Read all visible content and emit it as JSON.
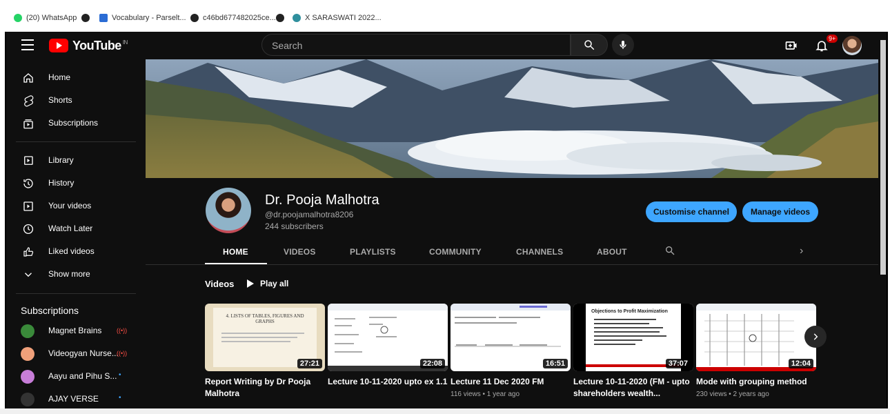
{
  "bookmarks": [
    {
      "label": "(20) WhatsApp",
      "color": "#25d366"
    },
    {
      "label": "",
      "color": "#333333"
    },
    {
      "label": "Vocabulary - Parselt...",
      "color": "#2b6cd4"
    },
    {
      "label": "c46bd677482025ce...",
      "color": "#333333"
    },
    {
      "label": "",
      "color": "#333333"
    },
    {
      "label": "X SARASWATI 2022...",
      "color": "#2f8f9d"
    }
  ],
  "topbar": {
    "logo_text": "YouTube",
    "region": "IN",
    "search_placeholder": "Search",
    "notification_badge": "9+"
  },
  "sidebar": {
    "items": [
      {
        "label": "Home",
        "icon": "home-icon"
      },
      {
        "label": "Shorts",
        "icon": "shorts-icon"
      },
      {
        "label": "Subscriptions",
        "icon": "subscriptions-icon"
      },
      {
        "label": "Library",
        "icon": "library-icon"
      },
      {
        "label": "History",
        "icon": "history-icon"
      },
      {
        "label": "Your videos",
        "icon": "your-videos-icon"
      },
      {
        "label": "Watch Later",
        "icon": "clock-icon"
      },
      {
        "label": "Liked videos",
        "icon": "thumbs-up-icon"
      },
      {
        "label": "Show more",
        "icon": "chevron-down-icon"
      }
    ],
    "subscriptions_title": "Subscriptions",
    "subscriptions": [
      {
        "label": "Magnet Brains",
        "live": true,
        "color": "#3a8a3a"
      },
      {
        "label": "Videogyan Nurse...",
        "live": true,
        "color": "#f0a07a"
      },
      {
        "label": "Aayu and Pihu S...",
        "live": false,
        "color": "#c77dd8"
      },
      {
        "label": "AJAY VERSE",
        "live": false,
        "color": "#333333"
      }
    ]
  },
  "channel": {
    "name": "Dr. Pooja Malhotra",
    "handle": "@dr.poojamalhotra8206",
    "subscribers": "244 subscribers",
    "customise_label": "Customise channel",
    "manage_label": "Manage videos"
  },
  "tabs": [
    "HOME",
    "VIDEOS",
    "PLAYLISTS",
    "COMMUNITY",
    "CHANNELS",
    "ABOUT"
  ],
  "section": {
    "title": "Videos",
    "play_all": "Play all"
  },
  "videos": [
    {
      "title": "Report Writing by Dr Pooja Malhotra",
      "duration": "27:21",
      "meta": "",
      "thumb_heading": "4. LISTS OF TABLES, FIGURES AND GRAPHS",
      "thumb_color": "#e8dcc0"
    },
    {
      "title": "Lecture 10-11-2020 upto ex 1.1",
      "duration": "22:08",
      "meta": "",
      "thumb_heading": "",
      "thumb_color": "#ffffff"
    },
    {
      "title": "Lecture 11 Dec 2020 FM",
      "duration": "16:51",
      "meta": "116 views • 1 year ago",
      "thumb_heading": "",
      "thumb_color": "#ffffff"
    },
    {
      "title": "Lecture 10-11-2020 (FM - upto shareholders wealth...",
      "duration": "37:07",
      "meta": "",
      "thumb_heading": "Objections to Profit Maximization",
      "thumb_color": "#ffffff"
    },
    {
      "title": "Mode with grouping method",
      "duration": "12:04",
      "meta": "230 views • 2 years ago",
      "thumb_heading": "",
      "thumb_color": "#ffffff"
    }
  ]
}
